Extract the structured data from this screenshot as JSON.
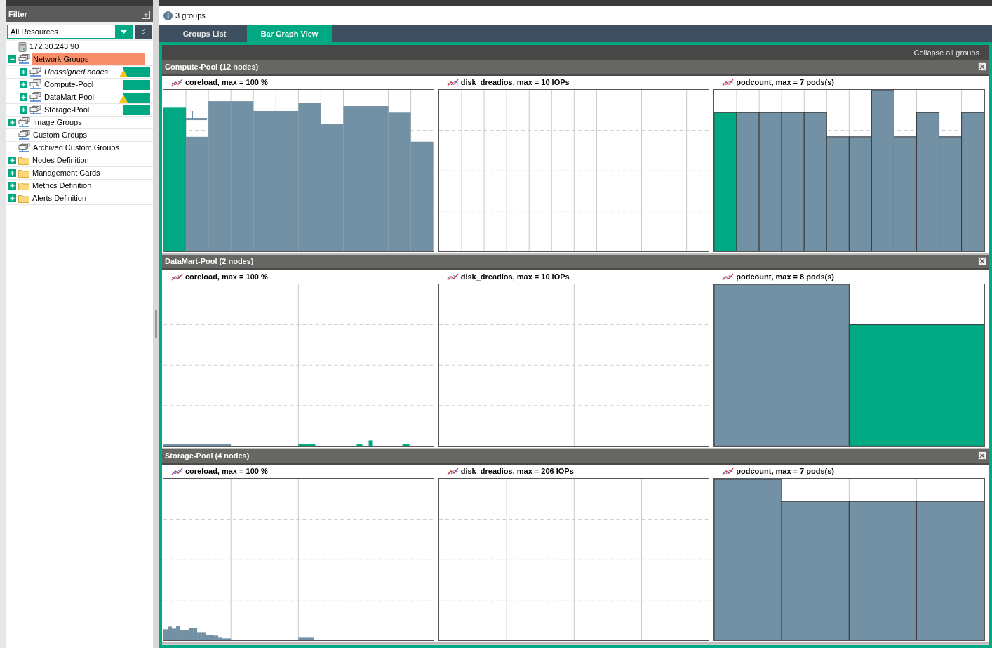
{
  "sidebar": {
    "title": "Filter",
    "dropdown": {
      "value": "All Resources"
    },
    "tree": [
      {
        "label": "172.30.243.90",
        "kind": "server",
        "selected": false
      },
      {
        "label": "Network Groups",
        "kind": "group",
        "expanded": true,
        "selected": true,
        "children": [
          {
            "label": "Unassigned nodes",
            "kind": "group",
            "expanded": false,
            "italic": true,
            "warning": true,
            "color": "#01a982"
          },
          {
            "label": "Compute-Pool",
            "kind": "group",
            "expanded": false,
            "italic": false,
            "warning": false,
            "color": "#01a982"
          },
          {
            "label": "DataMart-Pool",
            "kind": "group",
            "expanded": false,
            "italic": false,
            "warning": true,
            "color": "#01a982"
          },
          {
            "label": "Storage-Pool",
            "kind": "group",
            "expanded": false,
            "italic": false,
            "warning": false,
            "color": "#01a982"
          }
        ]
      },
      {
        "label": "Image Groups",
        "kind": "group",
        "expanded": false,
        "selected": false
      },
      {
        "label": "Custom Groups",
        "kind": "group",
        "selected": false
      },
      {
        "label": "Archived Custom Groups",
        "kind": "group",
        "selected": false
      },
      {
        "label": "Nodes Definition",
        "kind": "folder",
        "expanded": false,
        "selected": false
      },
      {
        "label": "Management Cards",
        "kind": "folder",
        "expanded": false,
        "selected": false
      },
      {
        "label": "Metrics Definition",
        "kind": "folder",
        "expanded": false,
        "selected": false
      },
      {
        "label": "Alerts Definition",
        "kind": "folder",
        "expanded": false,
        "selected": false
      }
    ]
  },
  "info": "3 groups",
  "tabs": [
    {
      "label": "Groups List",
      "selected": false
    },
    {
      "label": "Bar Graph View",
      "selected": true
    }
  ],
  "collapse_all": "Collapse all groups",
  "groups": [
    {
      "title": "Compute-Pool (12 nodes)",
      "charts": [
        {
          "title": "coreload, max = 100 %"
        },
        {
          "title": "disk_dreadios, max = 10 IOPs"
        },
        {
          "title": "podcount, max = 7 pods(s)"
        }
      ]
    },
    {
      "title": "DataMart-Pool (2 nodes)",
      "charts": [
        {
          "title": "coreload, max = 100 %"
        },
        {
          "title": "disk_dreadios, max = 10 IOPs"
        },
        {
          "title": "podcount, max = 8 pods(s)"
        }
      ]
    },
    {
      "title": "Storage-Pool (4 nodes)",
      "charts": [
        {
          "title": "coreload, max = 100 %"
        },
        {
          "title": "disk_dreadios, max = 206 IOPs"
        },
        {
          "title": "podcount, max = 7 pods(s)"
        }
      ]
    }
  ]
}
